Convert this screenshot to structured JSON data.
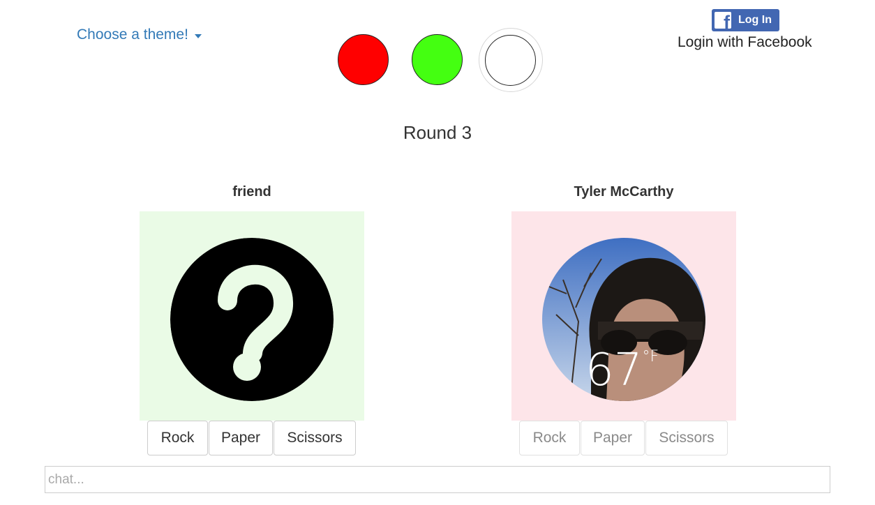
{
  "header": {
    "theme_label": "Choose a theme!",
    "results": [
      {
        "state": "loss",
        "color": "#ff0000"
      },
      {
        "state": "win",
        "color": "#44ff11"
      },
      {
        "state": "pending",
        "color": "#ffffff"
      }
    ]
  },
  "facebook": {
    "logo": "f",
    "login_label": "Log In",
    "caption": "Login with Facebook",
    "color": "#4267b2"
  },
  "round": {
    "title": "Round 3"
  },
  "players": [
    {
      "name": "friend",
      "panel_color": "#eafbe6",
      "avatar": "question-mark-icon",
      "buttons": [
        "Rock",
        "Paper",
        "Scissors"
      ],
      "buttons_enabled": true
    },
    {
      "name": "Tyler McCarthy",
      "panel_color": "#fde5e9",
      "avatar": "profile-photo",
      "photo_overlay_text": "67",
      "photo_overlay_unit": "°F",
      "buttons": [
        "Rock",
        "Paper",
        "Scissors"
      ],
      "buttons_enabled": false
    }
  ],
  "chat": {
    "placeholder": "chat...",
    "value": ""
  }
}
